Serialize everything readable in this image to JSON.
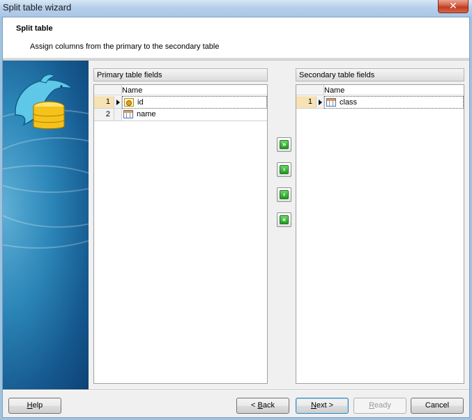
{
  "window": {
    "title": "Split table wizard",
    "close_label": "✕"
  },
  "header": {
    "title": "Split table",
    "subtitle": "Assign columns from the primary to the secondary table"
  },
  "primary": {
    "title": "Primary table fields",
    "column": "Name",
    "rows": [
      {
        "num": "1",
        "name": "id",
        "icon": "key-field-icon",
        "selected": true
      },
      {
        "num": "2",
        "name": "name",
        "icon": "field-icon",
        "selected": false
      }
    ]
  },
  "secondary": {
    "title": "Secondary table fields",
    "column": "Name",
    "rows": [
      {
        "num": "1",
        "name": "class",
        "icon": "field-icon",
        "selected": true
      }
    ]
  },
  "transfer_buttons": {
    "move_all_right": "»",
    "move_right": "›",
    "move_left": "‹",
    "move_all_left": "«"
  },
  "footer": {
    "help": {
      "mnemonic": "H",
      "rest": "elp"
    },
    "back": {
      "prefix": "< ",
      "mnemonic": "B",
      "rest": "ack"
    },
    "next": {
      "mnemonic": "N",
      "rest": "ext >"
    },
    "ready": {
      "mnemonic": "R",
      "rest": "eady"
    },
    "cancel": {
      "text": "Cancel"
    }
  }
}
